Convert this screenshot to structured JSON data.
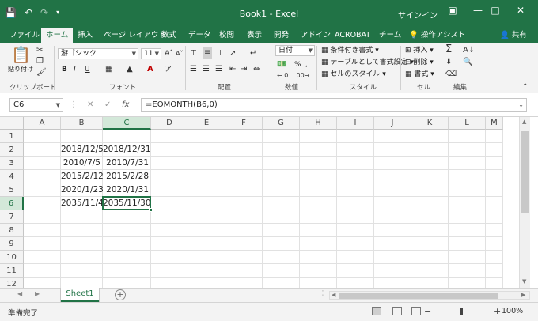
{
  "titlebar": {
    "title": "Book1 - Excel",
    "signin": "サインイン",
    "qat": [
      "save-icon",
      "undo-icon",
      "redo-icon",
      "customize-icon"
    ],
    "colors": {
      "brand": "#217346"
    }
  },
  "tabs": [
    {
      "label": "ファイル"
    },
    {
      "label": "ホーム"
    },
    {
      "label": "挿入"
    },
    {
      "label": "ページ レイアウト"
    },
    {
      "label": "数式"
    },
    {
      "label": "データ"
    },
    {
      "label": "校閲"
    },
    {
      "label": "表示"
    },
    {
      "label": "開発"
    },
    {
      "label": "アドイン"
    },
    {
      "label": "ACROBAT"
    },
    {
      "label": "チーム"
    },
    {
      "label": "操作アシスト"
    },
    {
      "label": "共有"
    }
  ],
  "ribbon": {
    "clipboard": {
      "paste": "貼り付け",
      "label": "クリップボード"
    },
    "font": {
      "name": "游ゴシック",
      "size": "11",
      "label": "フォント",
      "bold": "B",
      "italic": "I",
      "underline": "U"
    },
    "alignment": {
      "label": "配置"
    },
    "number": {
      "format": "日付",
      "label": "数値",
      "percent": "%"
    },
    "styles": {
      "conditional": "条件付き書式",
      "table": "テーブルとして書式設定",
      "cell": "セルのスタイル",
      "label": "スタイル"
    },
    "cells": {
      "insert": "挿入",
      "delete": "削除",
      "format": "書式",
      "label": "セル"
    },
    "editing": {
      "label": "編集"
    }
  },
  "formula_bar": {
    "name_box": "C6",
    "formula": "=EOMONTH(B6,0)"
  },
  "grid": {
    "columns": [
      "A",
      "B",
      "C",
      "D",
      "E",
      "F",
      "G",
      "H",
      "I",
      "J",
      "K",
      "L",
      "M"
    ],
    "rows": [
      "1",
      "2",
      "3",
      "4",
      "5",
      "6",
      "7",
      "8",
      "9",
      "10",
      "11",
      "12"
    ],
    "selected_col": "C",
    "selected_row": "6",
    "cells": {
      "B2": "2018/12/5",
      "C2": "2018/12/31",
      "B3": "2010/7/5",
      "C3": "2010/7/31",
      "B4": "2015/2/12",
      "C4": "2015/2/28",
      "B5": "2020/1/23",
      "C5": "2020/1/31",
      "B6": "2035/11/4",
      "C6": "2035/11/30"
    }
  },
  "sheets": {
    "tabs": [
      "Sheet1"
    ],
    "active": "Sheet1",
    "add": "+"
  },
  "status": {
    "ready": "準備完了",
    "zoom": "100%",
    "minus": "−",
    "plus": "+"
  }
}
